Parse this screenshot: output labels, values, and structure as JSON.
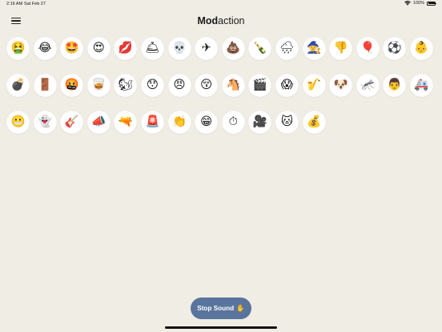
{
  "status_bar": {
    "time": "2:16 AM",
    "date": "Sat Feb 27",
    "battery": "100%"
  },
  "header": {
    "title_bold": "Mod",
    "title_rest": "action",
    "menu_icon": "hamburger-menu-icon"
  },
  "sounds": [
    {
      "name": "vomit-icon",
      "glyph": "🤮"
    },
    {
      "name": "laughing-icon",
      "glyph": "😂"
    },
    {
      "name": "star-struck-icon",
      "glyph": "🤩"
    },
    {
      "name": "heart-eyes-icon",
      "glyph": "😍"
    },
    {
      "name": "kiss-lips-icon",
      "glyph": "💋"
    },
    {
      "name": "bell-icon",
      "glyph": "🛎"
    },
    {
      "name": "skull-icon",
      "glyph": "💀"
    },
    {
      "name": "airplane-icon",
      "glyph": "✈"
    },
    {
      "name": "poop-icon",
      "glyph": "💩"
    },
    {
      "name": "champagne-icon",
      "glyph": "🍾"
    },
    {
      "name": "cloud-rain-icon",
      "glyph": "🌧"
    },
    {
      "name": "witch-icon",
      "glyph": "🧙"
    },
    {
      "name": "thumbs-down-icon",
      "glyph": "👎"
    },
    {
      "name": "balloon-icon",
      "glyph": "🎈"
    },
    {
      "name": "soccer-ball-icon",
      "glyph": "⚽"
    },
    {
      "name": "baby-icon",
      "glyph": "👶"
    },
    {
      "name": "bomb-icon",
      "glyph": "💣"
    },
    {
      "name": "door-icon",
      "glyph": "🚪"
    },
    {
      "name": "angry-face-icon",
      "glyph": "🤬"
    },
    {
      "name": "whiskey-glass-icon",
      "glyph": "🥃"
    },
    {
      "name": "squirrel-icon",
      "glyph": "🐿"
    },
    {
      "name": "astonished-face-icon",
      "glyph": "😯"
    },
    {
      "name": "pouting-face-icon",
      "glyph": "😠"
    },
    {
      "name": "kissing-face-icon",
      "glyph": "😚"
    },
    {
      "name": "horse-icon",
      "glyph": "🐴"
    },
    {
      "name": "clapperboard-icon",
      "glyph": "🎬"
    },
    {
      "name": "screaming-face-icon",
      "glyph": "😱"
    },
    {
      "name": "saxophone-icon",
      "glyph": "🎷"
    },
    {
      "name": "dog-icon",
      "glyph": "🐶"
    },
    {
      "name": "mosquito-icon",
      "glyph": "🦟"
    },
    {
      "name": "man-icon",
      "glyph": "👨"
    },
    {
      "name": "ambulance-icon",
      "glyph": "🚑"
    },
    {
      "name": "grimacing-face-icon",
      "glyph": "😬"
    },
    {
      "name": "ghost-icon",
      "glyph": "👻"
    },
    {
      "name": "guitar-icon",
      "glyph": "🎸"
    },
    {
      "name": "megaphone-icon",
      "glyph": "📣"
    },
    {
      "name": "water-pistol-icon",
      "glyph": "🔫"
    },
    {
      "name": "siren-light-icon",
      "glyph": "🚨"
    },
    {
      "name": "clapping-hands-icon",
      "glyph": "👏"
    },
    {
      "name": "grinning-face-icon",
      "glyph": "😁"
    },
    {
      "name": "stopwatch-icon",
      "glyph": "⏱"
    },
    {
      "name": "movie-camera-icon",
      "glyph": "🎥"
    },
    {
      "name": "cat-icon",
      "glyph": "🐱"
    },
    {
      "name": "money-bag-icon",
      "glyph": "💰"
    }
  ],
  "stop_button": {
    "label": "Stop Sound",
    "icon": "✋",
    "color": "#59749d"
  },
  "colors": {
    "background": "#f0ede5",
    "button": "#ffffff"
  }
}
